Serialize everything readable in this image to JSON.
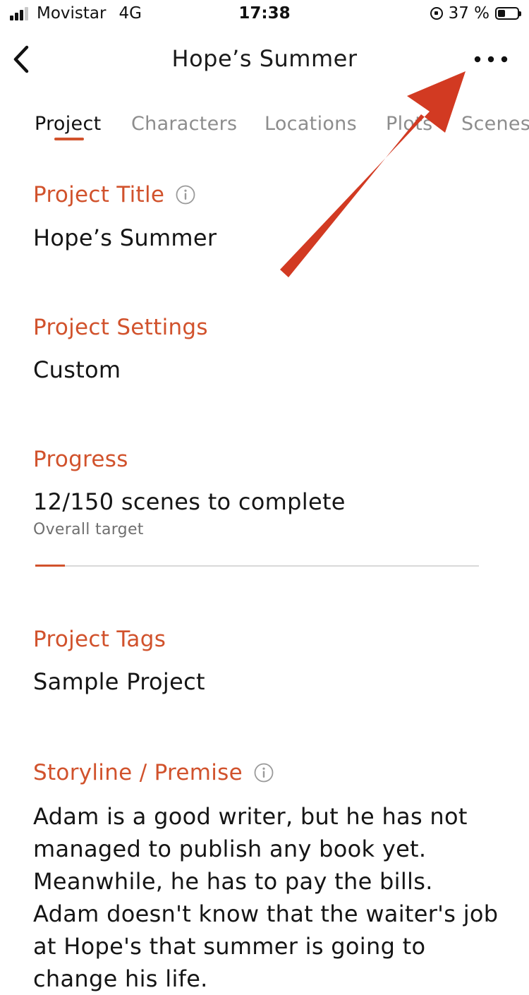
{
  "status_bar": {
    "carrier": "Movistar",
    "network": "4G",
    "time": "17:38",
    "battery_text": "37 %",
    "battery_level": 0.37
  },
  "nav": {
    "title": "Hope’s Summer"
  },
  "tabs": [
    {
      "label": "Project",
      "active": true
    },
    {
      "label": "Characters",
      "active": false
    },
    {
      "label": "Locations",
      "active": false
    },
    {
      "label": "Plots",
      "active": false
    },
    {
      "label": "Scenes",
      "active": false
    }
  ],
  "sections": {
    "title": {
      "label": "Project Title",
      "value": "Hope’s Summer"
    },
    "settings": {
      "label": "Project Settings",
      "value": "Custom"
    },
    "progress": {
      "label": "Progress",
      "value": "12/150 scenes to complete",
      "caption": "Overall target",
      "fraction": 0.067
    },
    "tags": {
      "label": "Project Tags",
      "value": "Sample Project"
    },
    "storyline": {
      "label": "Storyline / Premise",
      "text": "Adam is a good writer, but he has not managed to publish any book yet. Meanwhile, he has to pay the bills. Adam doesn't know that the waiter's job at Hope's that summer is going to change his life."
    }
  },
  "colors": {
    "accent": "#d1522c",
    "annotation_arrow": "#d23a22",
    "inactive_tab": "#8d8d8d"
  },
  "icons": {
    "back": "chevron-left-icon",
    "more": "more-horizontal-icon",
    "info": "info-icon"
  }
}
